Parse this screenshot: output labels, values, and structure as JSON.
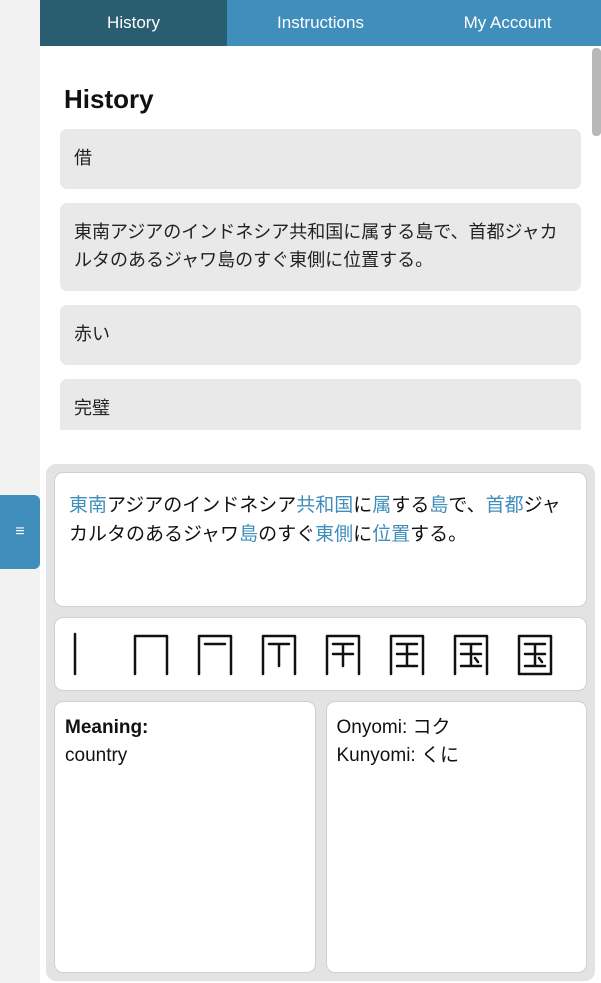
{
  "tabs": {
    "history": "History",
    "instructions": "Instructions",
    "account": "My Account",
    "active": "history"
  },
  "drawer_icon": "≡",
  "history": {
    "title": "History",
    "items": [
      "借",
      "東南アジアのインドネシア共和国に属する島で、首都ジャカルタのあるジャワ島のすぐ東側に位置する。",
      "赤い",
      "完璧"
    ]
  },
  "detail": {
    "sentence_segments": [
      {
        "t": "東南",
        "hl": true
      },
      {
        "t": "アジアのインドネシア",
        "hl": false
      },
      {
        "t": "共和国",
        "hl": true
      },
      {
        "t": "に",
        "hl": false
      },
      {
        "t": "属",
        "hl": true
      },
      {
        "t": "する",
        "hl": false
      },
      {
        "t": "島",
        "hl": true
      },
      {
        "t": "で、",
        "hl": false
      },
      {
        "t": "首都",
        "hl": true
      },
      {
        "t": "ジャカルタのあるジャワ",
        "hl": false
      },
      {
        "t": "島",
        "hl": true
      },
      {
        "t": "のすぐ",
        "hl": false
      },
      {
        "t": "東側",
        "hl": true
      },
      {
        "t": "に",
        "hl": false
      },
      {
        "t": "位置",
        "hl": true
      },
      {
        "t": "する。",
        "hl": false
      }
    ],
    "kanji": "国",
    "meaning": {
      "label": "Meaning:",
      "value": "country"
    },
    "readings": {
      "onyomi": {
        "label": "Onyomi:",
        "value": "コク"
      },
      "kunyomi": {
        "label": "Kunyomi:",
        "value": "くに"
      }
    }
  }
}
